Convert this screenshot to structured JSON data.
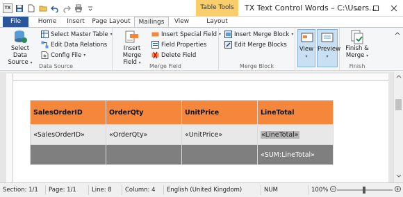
{
  "titlebar": {
    "app_logo": "TX",
    "context_tab_header": "Table Tools",
    "window_title": "TX Text Control Words – C:\\Users...",
    "qat_icons": [
      "save-icon",
      "new-document-icon",
      "open-folder-icon",
      "undo-icon",
      "redo-icon",
      "print-icon",
      "customize-icon"
    ]
  },
  "tabs": [
    "File",
    "Home",
    "Insert",
    "Page Layout",
    "Mailings",
    "View",
    "Layout"
  ],
  "active_tab": "Mailings",
  "ribbon": {
    "data_source": {
      "label": "Data Source",
      "select_data_source": "Select Data Source",
      "select_master_table": "Select Master Table",
      "edit_data_relations": "Edit Data Relations",
      "config_file": "Config File"
    },
    "merge_field": {
      "label": "Merge Field",
      "insert_merge_field": "Insert Merge Field",
      "insert_special_field": "Insert Special Field",
      "field_properties": "Field Properties",
      "delete_field": "Delete Field"
    },
    "merge_block": {
      "label": "Merge Block",
      "insert_merge_block": "Insert Merge Block",
      "edit_merge_blocks": "Edit Merge Blocks"
    },
    "view_group": {
      "view": "View",
      "preview": "Preview"
    },
    "finish": {
      "label": "Finish",
      "finish_merge": "Finish & Merge"
    }
  },
  "table": {
    "headers": [
      "SalesOrderID",
      "OrderQty",
      "UnitPrice",
      "LineTotal"
    ],
    "data_row": [
      "«SalesOrderID»",
      "«OrderQty»",
      "«UnitPrice»",
      "«LineTotal»"
    ],
    "sum_row": [
      "",
      "",
      "",
      "«SUM:LineTotal»"
    ],
    "colors": {
      "header_bg": "#f5873c",
      "data_bg": "#e8e8e8",
      "sum_bg": "#7f7f7f"
    }
  },
  "status": {
    "section": "Section: 1/1",
    "page": "Page: 1/1",
    "line": "Line: 8",
    "column": "Column: 4",
    "language": "English (United Kingdom)",
    "num": "NUM",
    "zoom": "100%"
  },
  "colors": {
    "accent": "#2b579a",
    "context_tab": "#f8cd6a"
  }
}
